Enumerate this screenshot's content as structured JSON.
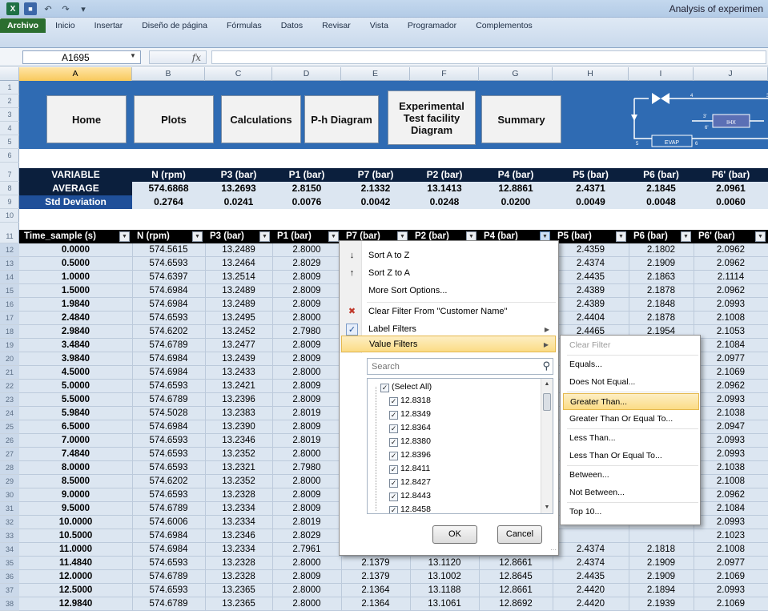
{
  "window": {
    "title": "Analysis of experimen"
  },
  "ribbon": {
    "tabs": [
      "Archivo",
      "Inicio",
      "Insertar",
      "Diseño de página",
      "Fórmulas",
      "Datos",
      "Revisar",
      "Vista",
      "Programador",
      "Complementos"
    ]
  },
  "formula_bar": {
    "name_box": "A1695",
    "fx": "fx",
    "value": ""
  },
  "columns": [
    "A",
    "B",
    "C",
    "D",
    "E",
    "F",
    "G",
    "H",
    "I",
    "J"
  ],
  "active_column": "A",
  "rows": [
    "1",
    "2",
    "3",
    "4",
    "5",
    "6",
    "7",
    "8",
    "9",
    "10",
    "11",
    "12",
    "13",
    "14",
    "15",
    "16",
    "17",
    "18",
    "19",
    "20",
    "21",
    "22",
    "23",
    "24",
    "25",
    "26",
    "27",
    "28",
    "29",
    "30",
    "31",
    "32",
    "33",
    "34",
    "35",
    "36",
    "37",
    "38"
  ],
  "nav_buttons": [
    "Home",
    "Plots",
    "Calculations",
    "P-h Diagram",
    "Experimental Test facility Diagram",
    "Summary"
  ],
  "diagram": {
    "labels": [
      "IHX",
      "EVAP",
      "3",
      "4",
      "5",
      "6",
      "3'",
      "6'"
    ]
  },
  "colors": {
    "banner": "#2f6bb3",
    "header_dark": "#0b1f3d",
    "row_header_fill": "#dce6f1",
    "grid_fill": "#dce6f1"
  },
  "summary": {
    "variable": [
      "VARIABLE",
      "N (rpm)",
      "P3 (bar)",
      "P1 (bar)",
      "P7 (bar)",
      "P2 (bar)",
      "P4 (bar)",
      "P5 (bar)",
      "P6 (bar)",
      "P6' (bar)"
    ],
    "average": [
      "AVERAGE",
      "574.6868",
      "13.2693",
      "2.8150",
      "2.1332",
      "13.1413",
      "12.8861",
      "2.4371",
      "2.1845",
      "2.0961"
    ],
    "std": [
      "Std Deviation",
      "0.2764",
      "0.0241",
      "0.0076",
      "0.0042",
      "0.0248",
      "0.0200",
      "0.0049",
      "0.0048",
      "0.0060"
    ]
  },
  "table_headers": [
    "Time_sample (s)",
    "N (rpm)",
    "P3 (bar)",
    "P1 (bar)",
    "P7 (bar)",
    "P2 (bar)",
    "P4 (bar)",
    "P5 (bar)",
    "P6 (bar)",
    "P6' (bar)"
  ],
  "data_rows": [
    [
      "0.0000",
      "574.5615",
      "13.2489",
      "2.8000",
      "",
      "",
      "",
      "2.4359",
      "2.1802",
      "2.0962"
    ],
    [
      "0.5000",
      "574.6593",
      "13.2464",
      "2.8029",
      "",
      "",
      "",
      "2.4374",
      "2.1909",
      "2.0962"
    ],
    [
      "1.0000",
      "574.6397",
      "13.2514",
      "2.8009",
      "",
      "",
      "",
      "2.4435",
      "2.1863",
      "2.1114"
    ],
    [
      "1.5000",
      "574.6984",
      "13.2489",
      "2.8009",
      "",
      "",
      "",
      "2.4389",
      "2.1878",
      "2.0962"
    ],
    [
      "1.9840",
      "574.6984",
      "13.2489",
      "2.8009",
      "",
      "",
      "",
      "2.4389",
      "2.1848",
      "2.0993"
    ],
    [
      "2.4840",
      "574.6593",
      "13.2495",
      "2.8000",
      "",
      "",
      "",
      "2.4404",
      "2.1878",
      "2.1008"
    ],
    [
      "2.9840",
      "574.6202",
      "13.2452",
      "2.7980",
      "",
      "",
      "",
      "2.4465",
      "2.1954",
      "2.1053"
    ],
    [
      "3.4840",
      "574.6789",
      "13.2477",
      "2.8009",
      "",
      "",
      "",
      "",
      "",
      "2.1084"
    ],
    [
      "3.9840",
      "574.6984",
      "13.2439",
      "2.8009",
      "",
      "",
      "",
      "",
      "",
      "2.0977"
    ],
    [
      "4.5000",
      "574.6984",
      "13.2433",
      "2.8000",
      "",
      "",
      "",
      "",
      "",
      "2.1069"
    ],
    [
      "5.0000",
      "574.6593",
      "13.2421",
      "2.8009",
      "",
      "",
      "",
      "",
      "",
      "2.0962"
    ],
    [
      "5.5000",
      "574.6789",
      "13.2396",
      "2.8009",
      "",
      "",
      "",
      "",
      "",
      "2.0993"
    ],
    [
      "5.9840",
      "574.5028",
      "13.2383",
      "2.8019",
      "",
      "",
      "",
      "",
      "",
      "2.1038"
    ],
    [
      "6.5000",
      "574.6984",
      "13.2390",
      "2.8009",
      "",
      "",
      "",
      "",
      "",
      "2.0947"
    ],
    [
      "7.0000",
      "574.6593",
      "13.2346",
      "2.8019",
      "",
      "",
      "",
      "",
      "",
      "2.0993"
    ],
    [
      "7.4840",
      "574.6593",
      "13.2352",
      "2.8000",
      "",
      "",
      "",
      "",
      "",
      "2.0993"
    ],
    [
      "8.0000",
      "574.6593",
      "13.2321",
      "2.7980",
      "",
      "",
      "",
      "",
      "",
      "2.1038"
    ],
    [
      "8.5000",
      "574.6202",
      "13.2352",
      "2.8000",
      "",
      "",
      "",
      "",
      "",
      "2.1008"
    ],
    [
      "9.0000",
      "574.6593",
      "13.2328",
      "2.8009",
      "",
      "",
      "",
      "",
      "",
      "2.0962"
    ],
    [
      "9.5000",
      "574.6789",
      "13.2334",
      "2.8009",
      "",
      "",
      "",
      "",
      "",
      "2.1084"
    ],
    [
      "10.0000",
      "574.6006",
      "13.2334",
      "2.8019",
      "",
      "",
      "",
      "",
      "",
      "2.0993"
    ],
    [
      "10.5000",
      "574.6984",
      "13.2346",
      "2.8029",
      "",
      "",
      "",
      "",
      "",
      "2.1023"
    ],
    [
      "11.0000",
      "574.6984",
      "13.2334",
      "2.7961",
      "",
      "",
      "",
      "2.4374",
      "2.1818",
      "2.1008"
    ],
    [
      "11.4840",
      "574.6593",
      "13.2328",
      "2.8000",
      "2.1379",
      "13.1120",
      "12.8661",
      "2.4374",
      "2.1909",
      "2.0977"
    ],
    [
      "12.0000",
      "574.6789",
      "13.2328",
      "2.8009",
      "2.1379",
      "13.1002",
      "12.8645",
      "2.4435",
      "2.1909",
      "2.1069"
    ],
    [
      "12.5000",
      "574.6593",
      "13.2365",
      "2.8000",
      "2.1364",
      "13.1188",
      "12.8661",
      "2.4420",
      "2.1894",
      "2.0993"
    ],
    [
      "12.9840",
      "574.6789",
      "13.2365",
      "2.8000",
      "2.1364",
      "13.1061",
      "12.8692",
      "2.4420",
      "2.1939",
      "2.1069"
    ]
  ],
  "filter_menu": {
    "sort_az": "Sort A to Z",
    "sort_za": "Sort Z to A",
    "more_sort": "More Sort Options...",
    "clear_filter": "Clear Filter From \"Customer Name\"",
    "label_filters": "Label Filters",
    "value_filters": "Value Filters",
    "search_placeholder": "Search",
    "select_all": "(Select All)",
    "values": [
      "12.8318",
      "12.8349",
      "12.8364",
      "12.8380",
      "12.8396",
      "12.8411",
      "12.8427",
      "12.8443",
      "12.8458"
    ],
    "ok": "OK",
    "cancel": "Cancel"
  },
  "value_filters_menu": [
    "Clear Filter",
    "Equals...",
    "Does Not Equal...",
    "Greater Than...",
    "Greater Than Or Equal To...",
    "Less Than...",
    "Less Than Or Equal To...",
    "Between...",
    "Not Between...",
    "Top 10..."
  ]
}
